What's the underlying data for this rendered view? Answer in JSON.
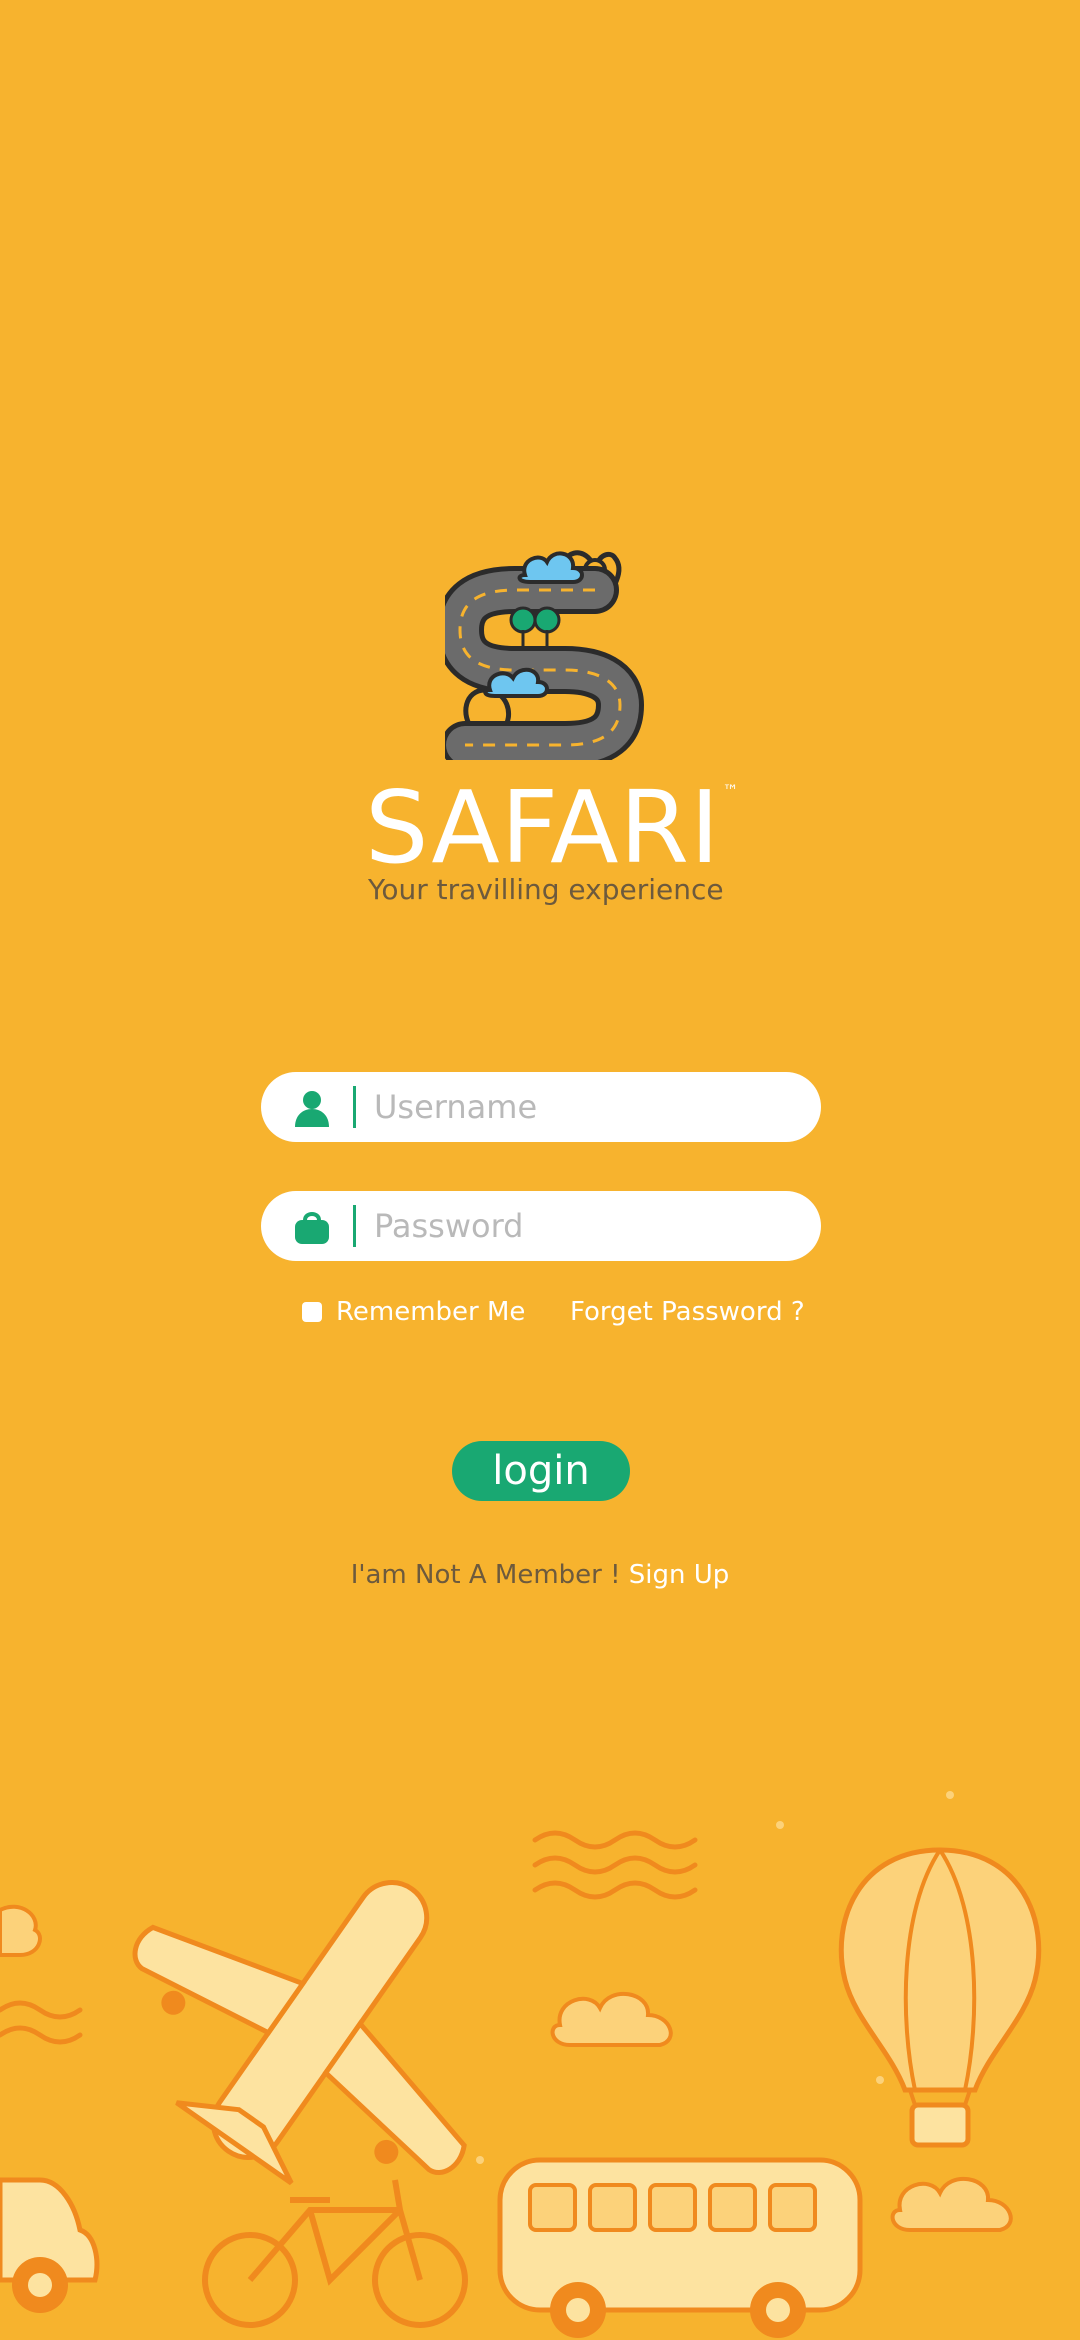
{
  "brand": {
    "name": "SAFARI",
    "trademark": "™",
    "tagline": "Your travilling experience"
  },
  "login_form": {
    "username_placeholder": "Username",
    "password_placeholder": "Password",
    "remember_label": "Remember Me",
    "remember_checked": false,
    "forget_label": "Forget Password ?",
    "login_label": "login"
  },
  "signup": {
    "prompt": "I'am Not A Member ! ",
    "link_label": "Sign Up"
  },
  "colors": {
    "background": "#F7B32E",
    "accent": "#19A872",
    "field_background": "#FFFFFF",
    "muted_text": "#6D5A3D"
  },
  "icons": [
    "road-logo-icon",
    "user-icon",
    "lock-icon",
    "checkbox-icon",
    "travel-illustration"
  ]
}
